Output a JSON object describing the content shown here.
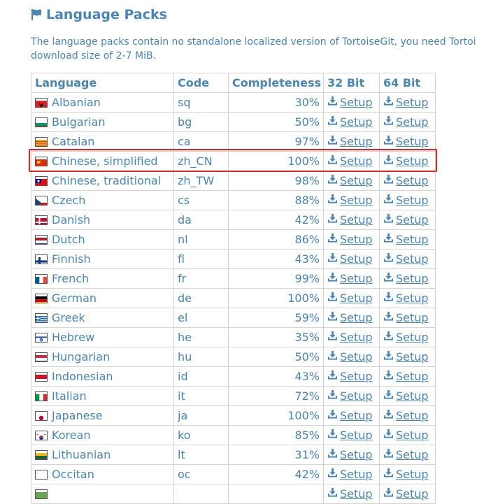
{
  "header": {
    "title": "Language Packs",
    "icon": "flag-icon"
  },
  "intro": {
    "line1": "The language packs contain no standalone localized version of TortoiseGit, you need Tortoi",
    "line2": "download size of 2-7 MiB."
  },
  "table": {
    "headers": [
      "Language",
      "Code",
      "Completeness",
      "32 Bit",
      "64 Bit"
    ],
    "setup_label": "Setup",
    "rows": [
      {
        "language": "Albanian",
        "code": "sq",
        "completeness": "30%",
        "flag": "albania"
      },
      {
        "language": "Bulgarian",
        "code": "bg",
        "completeness": "50%",
        "flag": "bulgaria"
      },
      {
        "language": "Catalan",
        "code": "ca",
        "completeness": "97%",
        "flag": "catalonia"
      },
      {
        "language": "Chinese, simplified",
        "code": "zh_CN",
        "completeness": "100%",
        "flag": "china",
        "highlighted": true
      },
      {
        "language": "Chinese, traditional",
        "code": "zh_TW",
        "completeness": "98%",
        "flag": "taiwan"
      },
      {
        "language": "Czech",
        "code": "cs",
        "completeness": "88%",
        "flag": "czech"
      },
      {
        "language": "Danish",
        "code": "da",
        "completeness": "42%",
        "flag": "denmark"
      },
      {
        "language": "Dutch",
        "code": "nl",
        "completeness": "86%",
        "flag": "netherlands"
      },
      {
        "language": "Finnish",
        "code": "fi",
        "completeness": "43%",
        "flag": "finland"
      },
      {
        "language": "French",
        "code": "fr",
        "completeness": "99%",
        "flag": "france"
      },
      {
        "language": "German",
        "code": "de",
        "completeness": "100%",
        "flag": "germany"
      },
      {
        "language": "Greek",
        "code": "el",
        "completeness": "59%",
        "flag": "greece"
      },
      {
        "language": "Hebrew",
        "code": "he",
        "completeness": "35%",
        "flag": "israel"
      },
      {
        "language": "Hungarian",
        "code": "hu",
        "completeness": "50%",
        "flag": "hungary"
      },
      {
        "language": "Indonesian",
        "code": "id",
        "completeness": "43%",
        "flag": "indonesia"
      },
      {
        "language": "Italian",
        "code": "it",
        "completeness": "72%",
        "flag": "italy"
      },
      {
        "language": "Japanese",
        "code": "ja",
        "completeness": "100%",
        "flag": "japan"
      },
      {
        "language": "Korean",
        "code": "ko",
        "completeness": "85%",
        "flag": "korea"
      },
      {
        "language": "Lithuanian",
        "code": "lt",
        "completeness": "31%",
        "flag": "lithuania"
      },
      {
        "language": "Occitan",
        "code": "oc",
        "completeness": "42%",
        "flag": "occitania"
      },
      {
        "language": "",
        "code": "",
        "completeness": "",
        "flag": "unknown"
      }
    ]
  },
  "colors": {
    "text": "#4a86b5",
    "border": "#d3d3d3",
    "highlight": "#e02424"
  }
}
